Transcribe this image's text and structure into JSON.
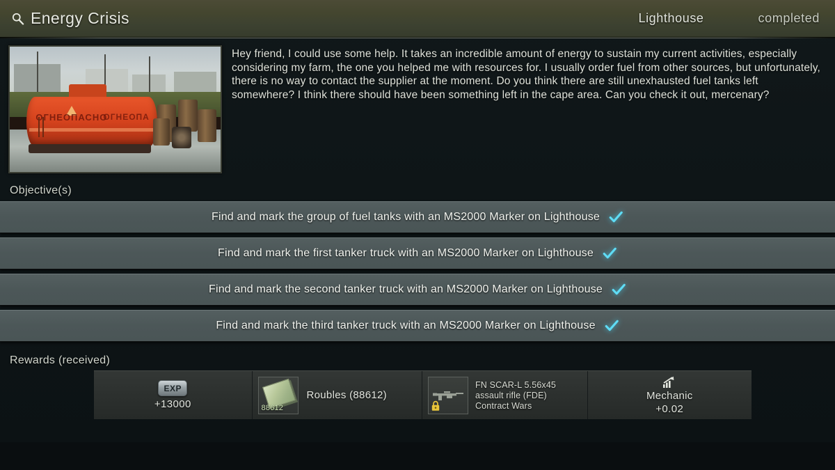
{
  "header": {
    "search_icon": "magnifier-icon",
    "title": "Energy Crisis",
    "location": "Lighthouse",
    "status": "completed"
  },
  "quest": {
    "image_alt": "orange fuel tanker trailer with barrels",
    "image_label_main": "ОГНЕОПАСНО",
    "image_label_side": "ОГНЕОПА",
    "description": "Hey friend, I could use some help. It takes an incredible amount of energy to sustain my current activities, especially considering my farm, the one you helped me with resources for. I usually order fuel from other sources, but unfortunately, there is no way to contact the supplier at the moment. Do you think there are still unexhausted fuel tanks left somewhere? I think there should have been something left in the cape area. Can you check it out, mercenary?"
  },
  "objectives": {
    "label": "Objective(s)",
    "items": [
      {
        "text": "Find and mark the group of fuel tanks with an MS2000 Marker on Lighthouse",
        "completed": true
      },
      {
        "text": "Find and mark the first tanker truck with an MS2000 Marker on Lighthouse",
        "completed": true
      },
      {
        "text": "Find and mark the second tanker truck with an MS2000 Marker on Lighthouse",
        "completed": true
      },
      {
        "text": "Find and mark the third tanker truck with an MS2000 Marker on Lighthouse",
        "completed": true
      }
    ]
  },
  "rewards": {
    "label": "Rewards (received)",
    "exp": {
      "badge": "EXP",
      "value": "+13000"
    },
    "money": {
      "name": "Roubles (88612)",
      "icon_count": "88612"
    },
    "item": {
      "line1": "FN SCAR-L 5.56x45",
      "line2": "assault rifle (FDE)",
      "line3": "Contract Wars",
      "locked": true
    },
    "trader": {
      "name": "Mechanic",
      "value": "+0.02"
    }
  },
  "colors": {
    "accent_check": "#4fd4f0",
    "header_band": "#44462f",
    "objective_row": "#4c5758",
    "reward_panel": "#2b2f2d",
    "lock_yellow": "#e8c53a"
  }
}
